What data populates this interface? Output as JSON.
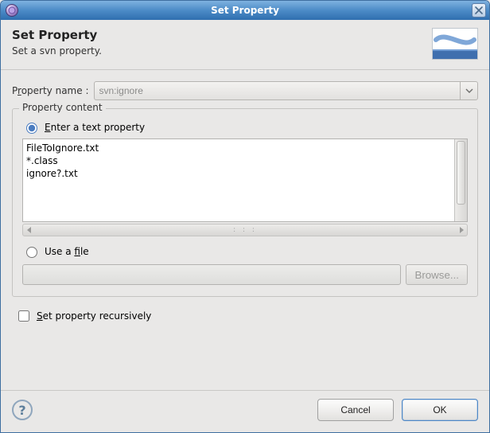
{
  "window": {
    "title": "Set Property"
  },
  "header": {
    "title": "Set Property",
    "subtitle": "Set a svn property."
  },
  "property": {
    "name_label_pre": "P",
    "name_label_u": "r",
    "name_label_post": "operty name :",
    "name_value": "svn:ignore"
  },
  "content_group": {
    "legend": "Property content",
    "enter_text_pre": "",
    "enter_text_u": "E",
    "enter_text_post": "nter a text property",
    "text_value": "FileToIgnore.txt\n*.class\nignore?.txt",
    "use_file_pre": "Use a ",
    "use_file_u": "f",
    "use_file_post": "ile",
    "file_path": "",
    "browse_label": "Browse...",
    "mode": "text"
  },
  "recursive": {
    "pre": "",
    "u": "S",
    "post": "et property recursively",
    "checked": false
  },
  "footer": {
    "cancel": "Cancel",
    "ok": "OK"
  }
}
